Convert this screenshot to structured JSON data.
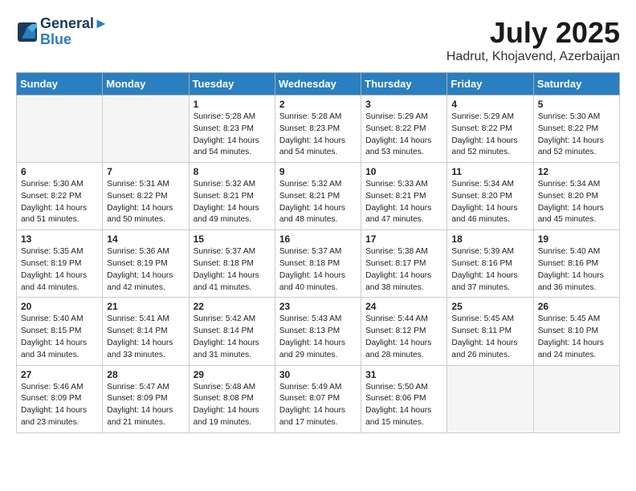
{
  "header": {
    "logo_line1": "General",
    "logo_line2": "Blue",
    "month_year": "July 2025",
    "location": "Hadrut, Khojavend, Azerbaijan"
  },
  "days_of_week": [
    "Sunday",
    "Monday",
    "Tuesday",
    "Wednesday",
    "Thursday",
    "Friday",
    "Saturday"
  ],
  "weeks": [
    [
      {
        "day": "",
        "empty": true
      },
      {
        "day": "",
        "empty": true
      },
      {
        "day": "1",
        "sunrise": "5:28 AM",
        "sunset": "8:23 PM",
        "daylight": "14 hours and 54 minutes."
      },
      {
        "day": "2",
        "sunrise": "5:28 AM",
        "sunset": "8:23 PM",
        "daylight": "14 hours and 54 minutes."
      },
      {
        "day": "3",
        "sunrise": "5:29 AM",
        "sunset": "8:22 PM",
        "daylight": "14 hours and 53 minutes."
      },
      {
        "day": "4",
        "sunrise": "5:29 AM",
        "sunset": "8:22 PM",
        "daylight": "14 hours and 52 minutes."
      },
      {
        "day": "5",
        "sunrise": "5:30 AM",
        "sunset": "8:22 PM",
        "daylight": "14 hours and 52 minutes."
      }
    ],
    [
      {
        "day": "6",
        "sunrise": "5:30 AM",
        "sunset": "8:22 PM",
        "daylight": "14 hours and 51 minutes."
      },
      {
        "day": "7",
        "sunrise": "5:31 AM",
        "sunset": "8:22 PM",
        "daylight": "14 hours and 50 minutes."
      },
      {
        "day": "8",
        "sunrise": "5:32 AM",
        "sunset": "8:21 PM",
        "daylight": "14 hours and 49 minutes."
      },
      {
        "day": "9",
        "sunrise": "5:32 AM",
        "sunset": "8:21 PM",
        "daylight": "14 hours and 48 minutes."
      },
      {
        "day": "10",
        "sunrise": "5:33 AM",
        "sunset": "8:21 PM",
        "daylight": "14 hours and 47 minutes."
      },
      {
        "day": "11",
        "sunrise": "5:34 AM",
        "sunset": "8:20 PM",
        "daylight": "14 hours and 46 minutes."
      },
      {
        "day": "12",
        "sunrise": "5:34 AM",
        "sunset": "8:20 PM",
        "daylight": "14 hours and 45 minutes."
      }
    ],
    [
      {
        "day": "13",
        "sunrise": "5:35 AM",
        "sunset": "8:19 PM",
        "daylight": "14 hours and 44 minutes."
      },
      {
        "day": "14",
        "sunrise": "5:36 AM",
        "sunset": "8:19 PM",
        "daylight": "14 hours and 42 minutes."
      },
      {
        "day": "15",
        "sunrise": "5:37 AM",
        "sunset": "8:18 PM",
        "daylight": "14 hours and 41 minutes."
      },
      {
        "day": "16",
        "sunrise": "5:37 AM",
        "sunset": "8:18 PM",
        "daylight": "14 hours and 40 minutes."
      },
      {
        "day": "17",
        "sunrise": "5:38 AM",
        "sunset": "8:17 PM",
        "daylight": "14 hours and 38 minutes."
      },
      {
        "day": "18",
        "sunrise": "5:39 AM",
        "sunset": "8:16 PM",
        "daylight": "14 hours and 37 minutes."
      },
      {
        "day": "19",
        "sunrise": "5:40 AM",
        "sunset": "8:16 PM",
        "daylight": "14 hours and 36 minutes."
      }
    ],
    [
      {
        "day": "20",
        "sunrise": "5:40 AM",
        "sunset": "8:15 PM",
        "daylight": "14 hours and 34 minutes."
      },
      {
        "day": "21",
        "sunrise": "5:41 AM",
        "sunset": "8:14 PM",
        "daylight": "14 hours and 33 minutes."
      },
      {
        "day": "22",
        "sunrise": "5:42 AM",
        "sunset": "8:14 PM",
        "daylight": "14 hours and 31 minutes."
      },
      {
        "day": "23",
        "sunrise": "5:43 AM",
        "sunset": "8:13 PM",
        "daylight": "14 hours and 29 minutes."
      },
      {
        "day": "24",
        "sunrise": "5:44 AM",
        "sunset": "8:12 PM",
        "daylight": "14 hours and 28 minutes."
      },
      {
        "day": "25",
        "sunrise": "5:45 AM",
        "sunset": "8:11 PM",
        "daylight": "14 hours and 26 minutes."
      },
      {
        "day": "26",
        "sunrise": "5:45 AM",
        "sunset": "8:10 PM",
        "daylight": "14 hours and 24 minutes."
      }
    ],
    [
      {
        "day": "27",
        "sunrise": "5:46 AM",
        "sunset": "8:09 PM",
        "daylight": "14 hours and 23 minutes."
      },
      {
        "day": "28",
        "sunrise": "5:47 AM",
        "sunset": "8:09 PM",
        "daylight": "14 hours and 21 minutes."
      },
      {
        "day": "29",
        "sunrise": "5:48 AM",
        "sunset": "8:08 PM",
        "daylight": "14 hours and 19 minutes."
      },
      {
        "day": "30",
        "sunrise": "5:49 AM",
        "sunset": "8:07 PM",
        "daylight": "14 hours and 17 minutes."
      },
      {
        "day": "31",
        "sunrise": "5:50 AM",
        "sunset": "8:06 PM",
        "daylight": "14 hours and 15 minutes."
      },
      {
        "day": "",
        "empty": true
      },
      {
        "day": "",
        "empty": true
      }
    ]
  ]
}
